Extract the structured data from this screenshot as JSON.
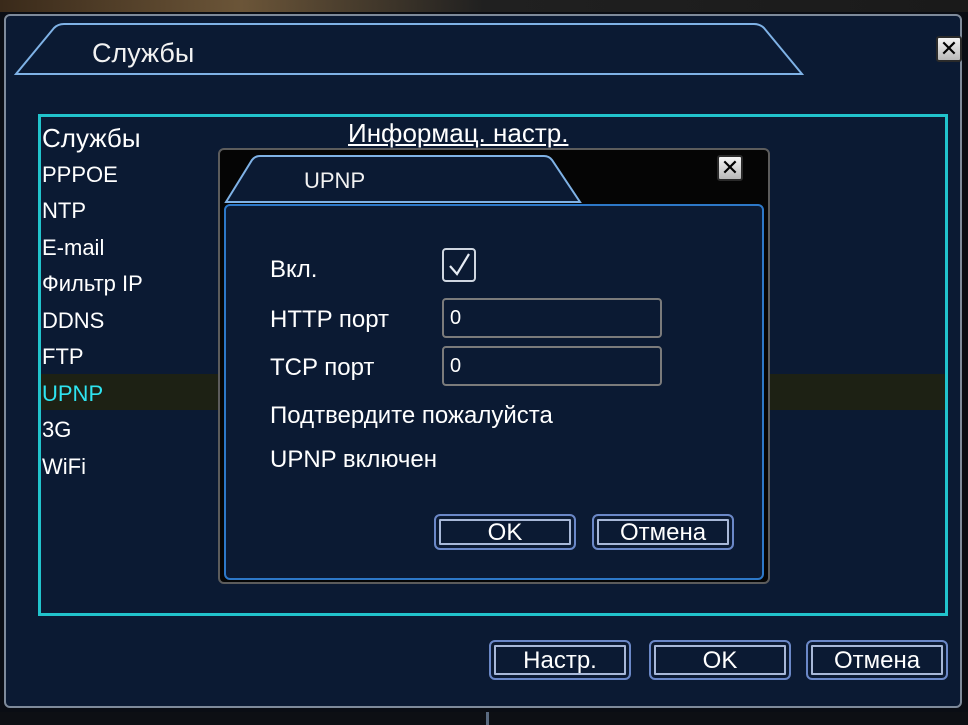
{
  "main_window": {
    "title": "Службы",
    "close_glyph": "✕",
    "list": {
      "header": "Службы",
      "items": [
        "PPPOE",
        "NTP",
        "E-mail",
        "Фильтр IP",
        "DDNS",
        "FTP",
        "UPNP",
        "3G",
        "WiFi"
      ],
      "selected": "UPNP"
    },
    "column_header": "Информац. настр.",
    "buttons": {
      "setup": "Настр.",
      "ok": "OK",
      "cancel": "Отмена"
    }
  },
  "dialog": {
    "title": "UPNP",
    "close_glyph": "✕",
    "enable_label": "Вкл.",
    "enable_checked": true,
    "http_port_label": "HTTP порт",
    "http_port_value": "0",
    "tcp_port_label": "TCP порт",
    "tcp_port_value": "0",
    "confirm_text": "Подтвердите пожалуйста",
    "status_text": "UPNP включен",
    "buttons": {
      "ok": "OK",
      "cancel": "Отмена"
    }
  },
  "colors": {
    "panel_bg": "#0b1a33",
    "frame_cyan": "#21c3cc",
    "selected_text": "#2ee4f0",
    "dialog_border": "#2d78c8"
  }
}
